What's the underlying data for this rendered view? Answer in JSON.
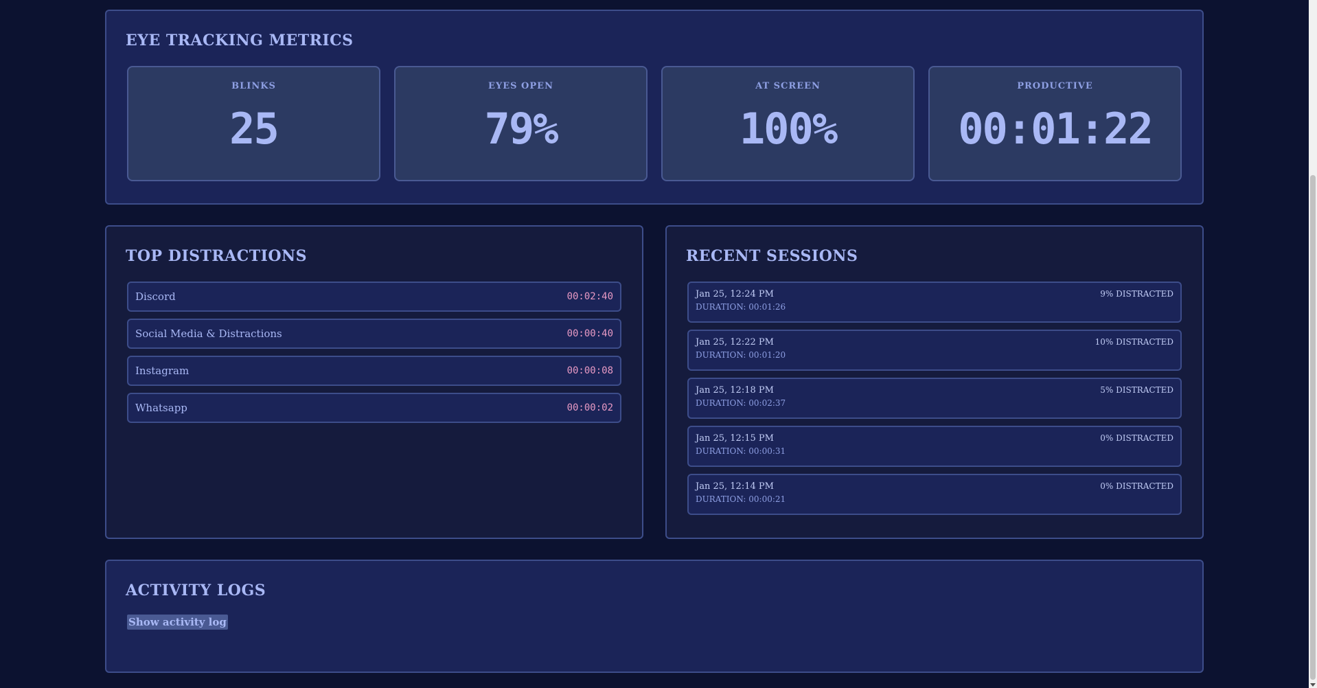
{
  "metrics": {
    "title": "EYE TRACKING METRICS",
    "cards": [
      {
        "label": "BLINKS",
        "value": "25"
      },
      {
        "label": "EYES OPEN",
        "value": "79%"
      },
      {
        "label": "AT SCREEN",
        "value": "100%"
      },
      {
        "label": "PRODUCTIVE",
        "value": "00:01:22"
      }
    ]
  },
  "distractions": {
    "title": "TOP DISTRACTIONS",
    "items": [
      {
        "name": "Discord",
        "time": "00:02:40"
      },
      {
        "name": "Social Media & Distractions",
        "time": "00:00:40"
      },
      {
        "name": "Instagram",
        "time": "00:00:08"
      },
      {
        "name": "Whatsapp",
        "time": "00:00:02"
      }
    ]
  },
  "sessions": {
    "title": "RECENT SESSIONS",
    "items": [
      {
        "date": "Jan 25, 12:24 PM",
        "duration": "DURATION: 00:01:26",
        "distracted": "9% DISTRACTED"
      },
      {
        "date": "Jan 25, 12:22 PM",
        "duration": "DURATION: 00:01:20",
        "distracted": "10% DISTRACTED"
      },
      {
        "date": "Jan 25, 12:18 PM",
        "duration": "DURATION: 00:02:37",
        "distracted": "5% DISTRACTED"
      },
      {
        "date": "Jan 25, 12:15 PM",
        "duration": "DURATION: 00:00:31",
        "distracted": "0% DISTRACTED"
      },
      {
        "date": "Jan 25, 12:14 PM",
        "duration": "DURATION: 00:00:21",
        "distracted": "0% DISTRACTED"
      }
    ]
  },
  "logs": {
    "title": "ACTIVITY LOGS",
    "toggle_label": "Show activity log"
  },
  "colors": {
    "background": "#0c1230",
    "panel": "#1b2458",
    "accent": "#a9b8f5",
    "time_pink": "#e89ac4"
  }
}
